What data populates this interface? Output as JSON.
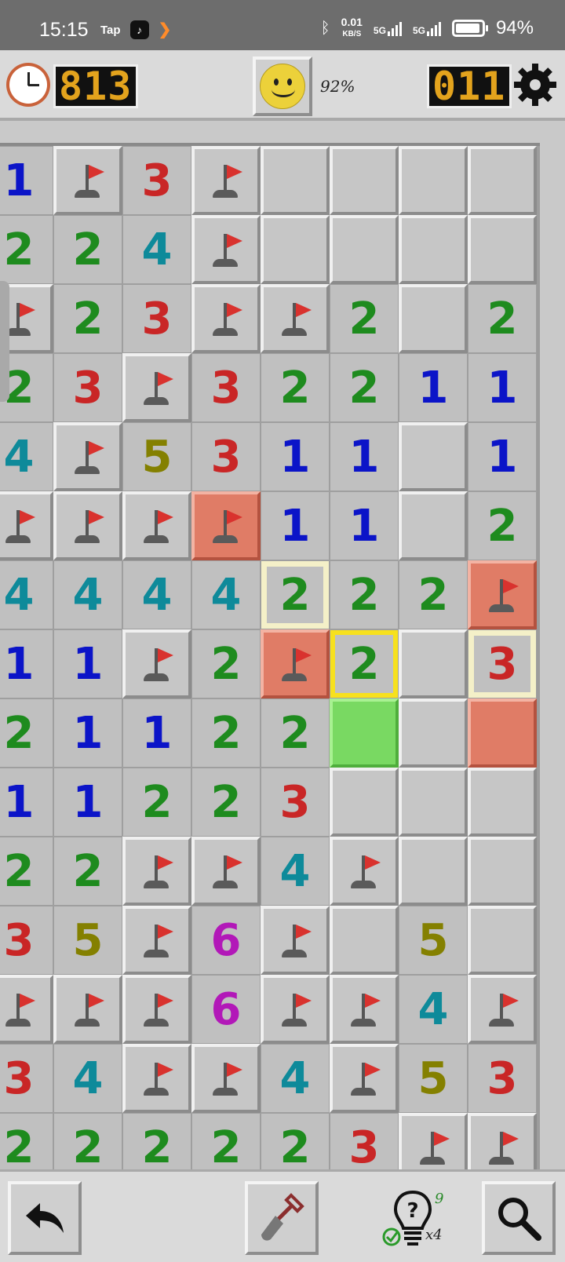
{
  "status_bar": {
    "time": "15:15",
    "tap_label": "Tap",
    "net_speed": "0.01",
    "net_unit": "KB/S",
    "sig1": "5G",
    "sig2": "5G",
    "battery_percent": "94%",
    "battery_level": 94
  },
  "header": {
    "timer": "813",
    "mines_left": "011",
    "progress_percent": "92%"
  },
  "colors": {
    "counter_digits": "#e3a31d",
    "flagged_wrong": "#e07c66",
    "safe_hint": "#79d962",
    "highlight_yellow": "#f7e11e"
  },
  "board": {
    "legend": "U=unrevealed, F=flag, RF=red flag, R=red, G=green, digits=revealed number, Y=yellow highlight, C=cream highlight",
    "rows": [
      [
        "1",
        "F",
        "3",
        "F",
        "U",
        "U",
        "U",
        "U"
      ],
      [
        "2",
        "2",
        "4",
        "F",
        "U",
        "U",
        "U",
        "U"
      ],
      [
        "F",
        "2",
        "3",
        "F",
        "F",
        "2",
        "U",
        "2"
      ],
      [
        "2",
        "3",
        "F",
        "3",
        "2",
        "2",
        "1",
        "1"
      ],
      [
        "4",
        "F",
        "5",
        "3",
        "1",
        "1",
        "U",
        "1"
      ],
      [
        "F",
        "F",
        "F",
        "RF",
        "1",
        "1",
        "U",
        "2"
      ],
      [
        "4",
        "4",
        "4",
        "4",
        "2C",
        "2",
        "2",
        "RF"
      ],
      [
        "1",
        "1",
        "F",
        "2",
        "RF",
        "2Y",
        "U",
        "3C"
      ],
      [
        "2",
        "1",
        "1",
        "2",
        "2",
        "G",
        "U",
        "R"
      ],
      [
        "1",
        "1",
        "2",
        "2",
        "3",
        "U",
        "U",
        "U"
      ],
      [
        "2",
        "2",
        "F",
        "F",
        "4",
        "F",
        "U",
        "U"
      ],
      [
        "3",
        "5",
        "F",
        "6",
        "F",
        "U",
        "5",
        "U"
      ],
      [
        "F",
        "F",
        "F",
        "6",
        "F",
        "F",
        "4",
        "F"
      ],
      [
        "3",
        "4",
        "F",
        "F",
        "4",
        "F",
        "5",
        "3"
      ],
      [
        "2",
        "2",
        "2",
        "2",
        "2",
        "3",
        "F",
        "F"
      ]
    ]
  },
  "toolbar": {
    "hint_count": "9",
    "hint_multiplier": "x4"
  }
}
